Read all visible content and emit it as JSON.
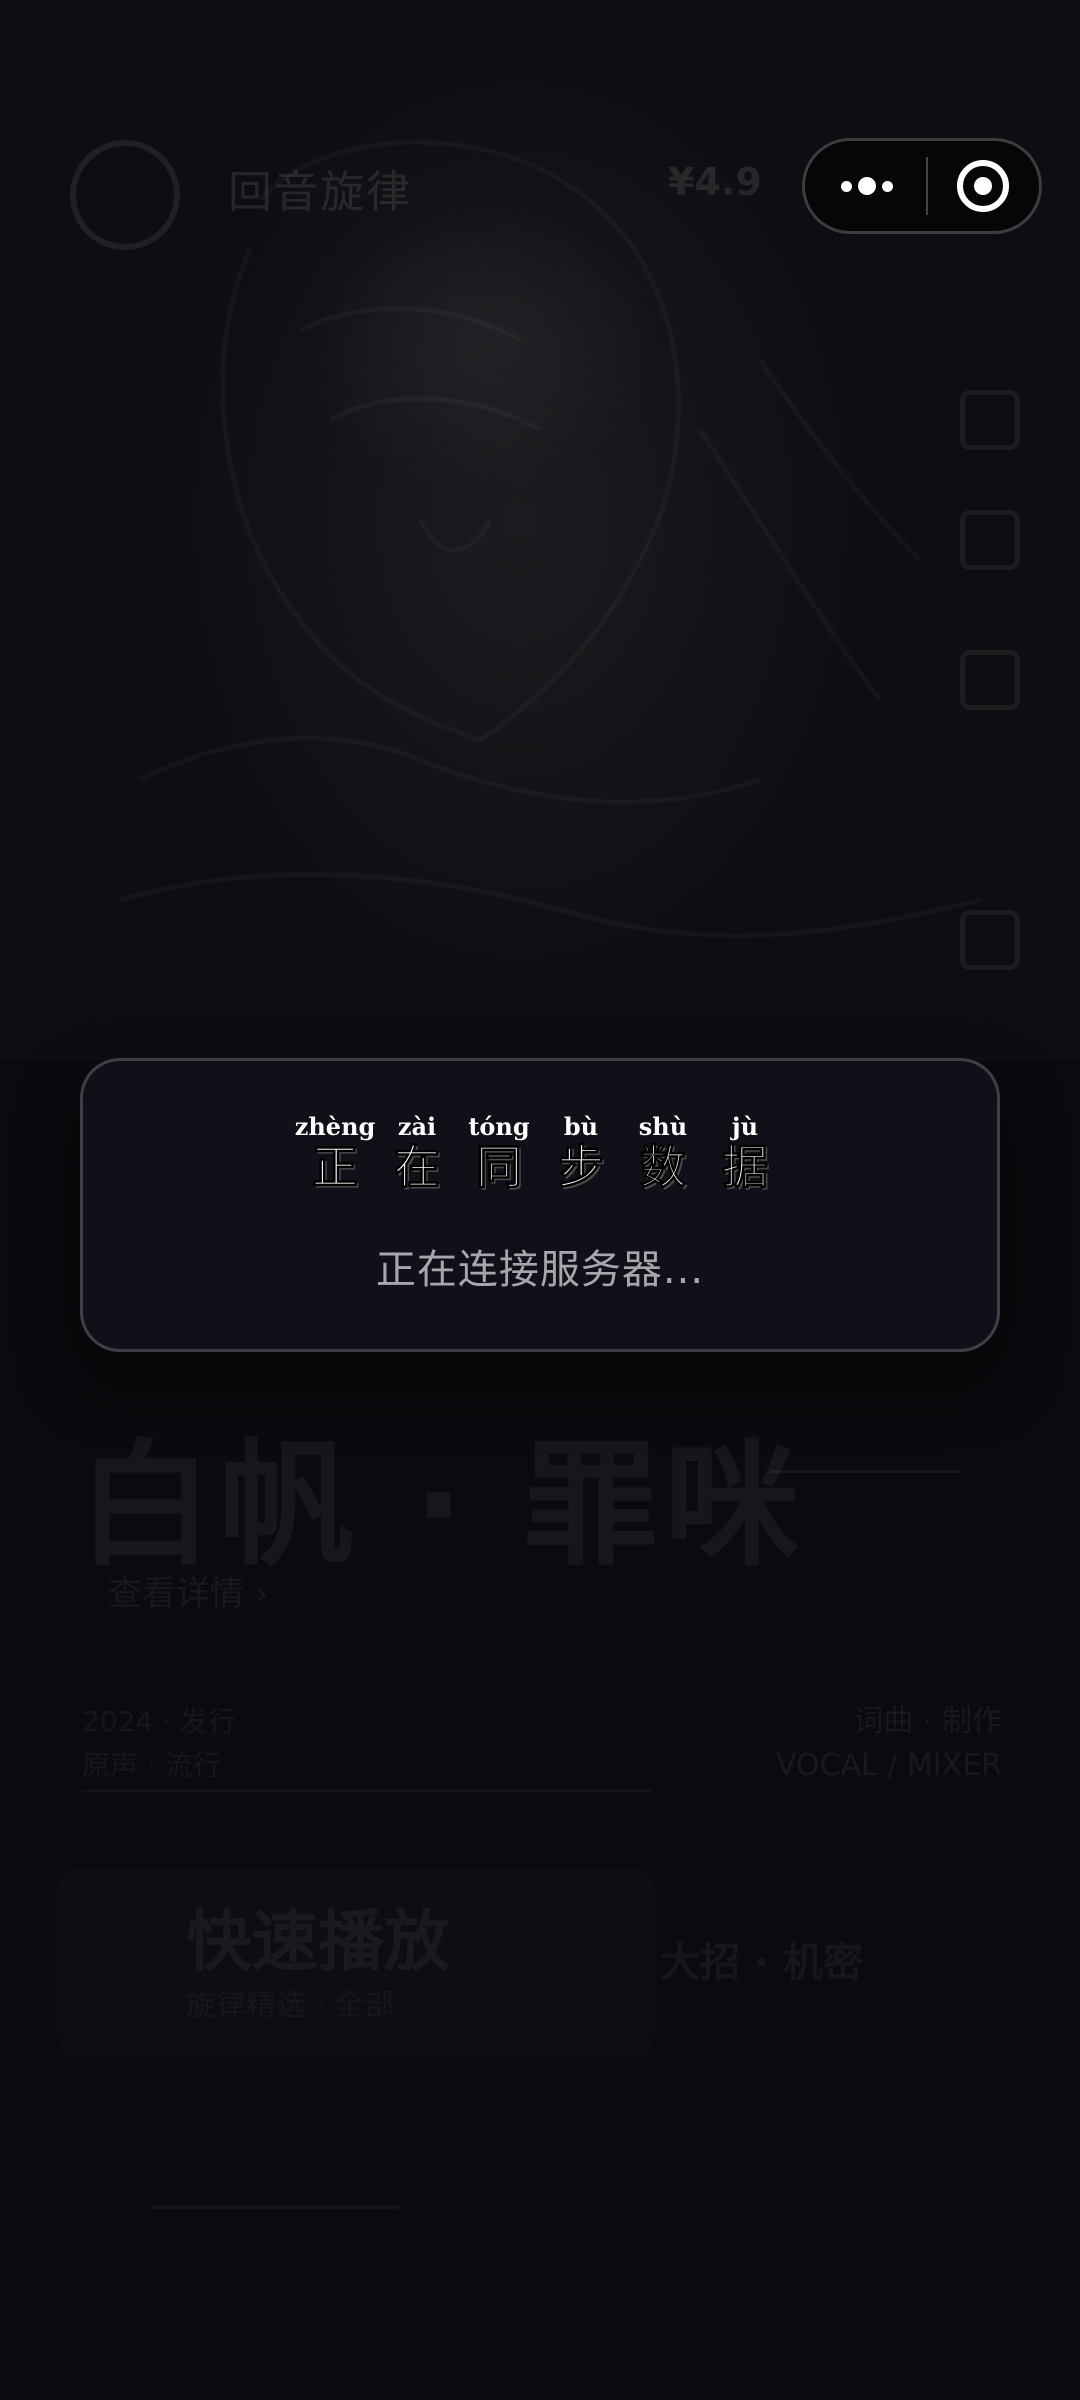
{
  "background": {
    "brand": "回音旋律",
    "chip": "¥4.9",
    "song_title": "白帆 · 罪咪",
    "artist_link": "查看详情 ›",
    "meta_left": [
      "2024 · 发行",
      "原声 · 流行"
    ],
    "meta_right": [
      "词曲 · 制作",
      "VOCAL / MIXER"
    ],
    "card": {
      "title": "快速播放",
      "subtitle": "旋律精选 · 全部",
      "right_text": "大招 · 机密"
    }
  },
  "capsule": {
    "menu_icon": "more-dots-icon",
    "close_icon": "target-icon"
  },
  "modal": {
    "title_chars": [
      {
        "pinyin": "zhèng",
        "hanzi": "正"
      },
      {
        "pinyin": "zài",
        "hanzi": "在"
      },
      {
        "pinyin": "tóng",
        "hanzi": "同"
      },
      {
        "pinyin": "bù",
        "hanzi": "步"
      },
      {
        "pinyin": "shù",
        "hanzi": "数"
      },
      {
        "pinyin": "jù",
        "hanzi": "据"
      }
    ],
    "subtitle": "正在连接服务器..."
  }
}
